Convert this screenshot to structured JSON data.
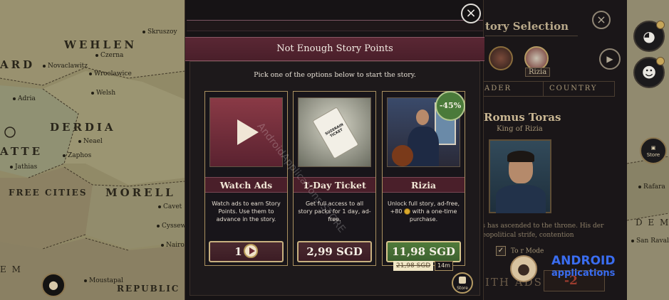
{
  "map": {
    "labels": {
      "wehlen": "WEHLEN",
      "czerna": "Czerna",
      "skruszoy": "Skruszoy",
      "wroclawice": "Wroclawice",
      "novaclawitz": "Novaclawitz",
      "welsh": "Welsh",
      "ard": "ARD",
      "adria": "Adria",
      "derdia": "DERDIA",
      "neael": "Neael",
      "atte": "ATTE",
      "zaphos": "Zaphos",
      "jathias": "Jathias",
      "free_cities": "FREE CITIES",
      "morell": "MORELL",
      "cavet": "Cavet",
      "cyssew": "Cyssew",
      "nairos": "Nairos",
      "em": "E M",
      "moustapal": "Moustapal",
      "republic_of": "REPUBLIC OF",
      "rafara": "Rafara",
      "dem": "D E M",
      "san_ravalo": "San Ravalo"
    }
  },
  "background_panel": {
    "title": "tory Selection",
    "country_tag": "Rizia",
    "tabs": [
      "ADER",
      "COUNTRY"
    ],
    "leader_name": "Romus Toras",
    "leader_role": "King of Rizia",
    "description": "as has ascended to the throne. His der geopolitical strife, contention",
    "toggle_label": "To  r Mode",
    "with_ads": "ITH ADS",
    "points": "-2"
  },
  "side_buttons": {
    "store_label": "Store"
  },
  "modal": {
    "header": "Not Enough Story Points",
    "subtitle": "Pick one of the options below to start the story.",
    "close_icon": "×",
    "cards": {
      "ads": {
        "title": "Watch Ads",
        "text": "Watch ads to earn Story Points. Use them to advance in the story.",
        "button_value": "1"
      },
      "ticket": {
        "title": "1-Day Ticket",
        "text": "Get full access to all story packs for 1 day, ad-free.",
        "ticket_brand": "SUZERAIN",
        "ticket_kind": "TICKET",
        "price": "2,99 SGD"
      },
      "rizia": {
        "title": "Rizia",
        "text_before": "Unlock full story, ad-free, +80",
        "text_after": "with a one-time purchase.",
        "price": "11,98 SGD",
        "old_price": "21,98 SGD",
        "discount": "-45%",
        "timer": "14m"
      }
    },
    "store_label": "Store"
  },
  "watermarks": {
    "diagonal": "AndroidApplications STORE",
    "brand_line1": "ANDROID",
    "brand_line2": "applications"
  }
}
